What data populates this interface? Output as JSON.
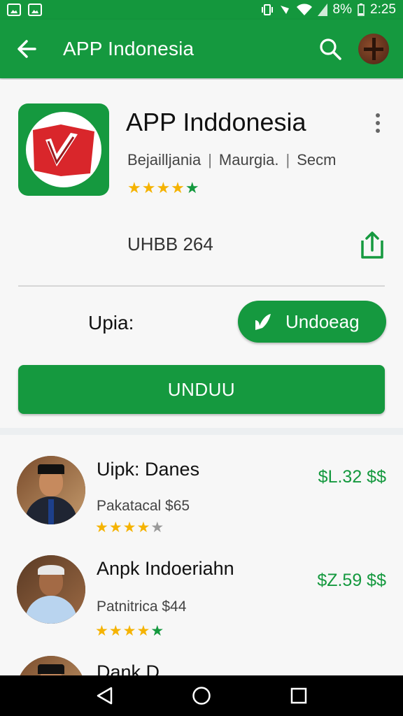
{
  "status_bar": {
    "battery": "8%",
    "time": "2:25"
  },
  "app_bar": {
    "title": "APP Indonesia"
  },
  "app": {
    "name": "APP Inddonesia",
    "meta": [
      "Bejailljania",
      "Maurgia.",
      "Secm"
    ],
    "rating_stars": 5,
    "size_text": "UHBB 264",
    "update_label": "Upia:",
    "download_label": "Undoeag",
    "install_label": "UNDUU"
  },
  "list": [
    {
      "name": "Uipk: Danes",
      "sub": "Pakatacal $65",
      "price": "$L.32 $$",
      "stars": 4,
      "photo": "person-peci"
    },
    {
      "name": "Anpk Indoeriahn",
      "sub": "Patnitrica $44",
      "price": "$Z.59 $$",
      "stars": 5,
      "photo": "person-gray-hair"
    },
    {
      "name": "Dank D",
      "photo": "person-peci"
    }
  ],
  "colors": {
    "brand": "#15993f",
    "star": "#f5b301"
  },
  "icons": [
    "back-arrow-icon",
    "search-icon",
    "more-vert-icon",
    "share-icon",
    "download-icon",
    "nav-back-icon",
    "nav-home-icon",
    "nav-recents-icon"
  ]
}
